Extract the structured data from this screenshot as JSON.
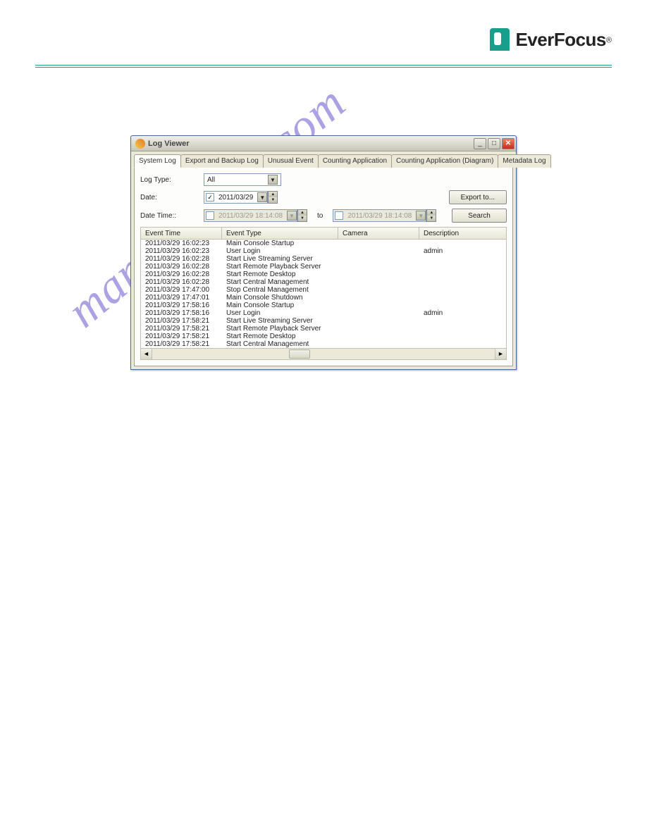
{
  "brand": {
    "name": "EverFocus",
    "reg": "®"
  },
  "watermark": "manualshive.com",
  "window": {
    "title": "Log Viewer",
    "tabs": [
      "System Log",
      "Export and Backup Log",
      "Unusual Event",
      "Counting Application",
      "Counting Application (Diagram)",
      "Metadata Log"
    ],
    "filters": {
      "log_type_label": "Log Type:",
      "log_type_value": "All",
      "date_label": "Date:",
      "date_value": "2011/03/29",
      "date_checked": "✓",
      "datetime_label": "Date Time::",
      "datetime_from": "2011/03/29 18:14:08",
      "to_label": "to",
      "datetime_to": "2011/03/29 18:14:08",
      "export_btn": "Export to...",
      "search_btn": "Search"
    },
    "columns": {
      "time": "Event Time",
      "type": "Event Type",
      "camera": "Camera",
      "desc": "Description"
    },
    "rows": [
      {
        "time": "2011/03/29 16:02:23",
        "type": "Main Console Startup",
        "cam": "",
        "desc": ""
      },
      {
        "time": "2011/03/29 16:02:23",
        "type": "User Login",
        "cam": "",
        "desc": "admin"
      },
      {
        "time": "2011/03/29 16:02:28",
        "type": "Start Live Streaming Server",
        "cam": "",
        "desc": ""
      },
      {
        "time": "2011/03/29 16:02:28",
        "type": "Start Remote Playback Server",
        "cam": "",
        "desc": ""
      },
      {
        "time": "2011/03/29 16:02:28",
        "type": "Start Remote Desktop",
        "cam": "",
        "desc": ""
      },
      {
        "time": "2011/03/29 16:02:28",
        "type": "Start Central Management",
        "cam": "",
        "desc": ""
      },
      {
        "time": "2011/03/29 17:47:00",
        "type": "Stop Central Management",
        "cam": "",
        "desc": ""
      },
      {
        "time": "2011/03/29 17:47:01",
        "type": "Main Console Shutdown",
        "cam": "",
        "desc": ""
      },
      {
        "time": "2011/03/29 17:58:16",
        "type": "Main Console Startup",
        "cam": "",
        "desc": ""
      },
      {
        "time": "2011/03/29 17:58:16",
        "type": "User Login",
        "cam": "",
        "desc": "admin"
      },
      {
        "time": "2011/03/29 17:58:21",
        "type": "Start Live Streaming Server",
        "cam": "",
        "desc": ""
      },
      {
        "time": "2011/03/29 17:58:21",
        "type": "Start Remote Playback Server",
        "cam": "",
        "desc": ""
      },
      {
        "time": "2011/03/29 17:58:21",
        "type": "Start Remote Desktop",
        "cam": "",
        "desc": ""
      },
      {
        "time": "2011/03/29 17:58:21",
        "type": "Start Central Management",
        "cam": "",
        "desc": ""
      }
    ]
  }
}
